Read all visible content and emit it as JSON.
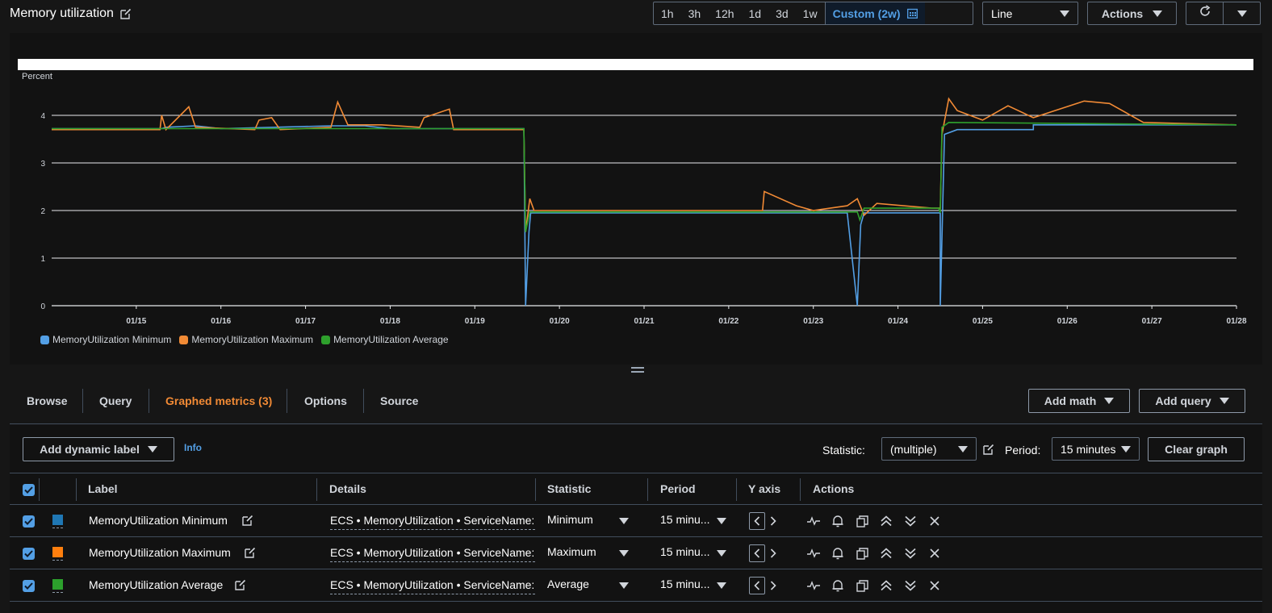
{
  "header": {
    "title": "Memory utilization",
    "time_ranges": [
      "1h",
      "3h",
      "12h",
      "1d",
      "3d",
      "1w"
    ],
    "custom_range": "Custom (2w)",
    "chart_type": "Line",
    "actions_label": "Actions"
  },
  "chart_data": {
    "type": "line",
    "ylabel": "Percent",
    "ylim": [
      0,
      4
    ],
    "yticks": [
      "0",
      "1",
      "2",
      "3",
      "4"
    ],
    "xticks": [
      "01/15",
      "01/16",
      "01/17",
      "01/18",
      "01/19",
      "01/20",
      "01/21",
      "01/22",
      "01/23",
      "01/24",
      "01/25",
      "01/26",
      "01/27",
      "01/28"
    ],
    "x_start": "01/14",
    "x_end": "01/28",
    "grid": "horizontal",
    "legend_position": "bottom-left",
    "series": [
      {
        "name": "MemoryUtilization Minimum",
        "color": "#539fe5",
        "points": [
          [
            "01/14",
            3.72
          ],
          [
            "01/15.3",
            3.72
          ],
          [
            "01/15.35",
            3.75
          ],
          [
            "01/15.7",
            3.78
          ],
          [
            "01/16",
            3.72
          ],
          [
            "01/17.3",
            3.78
          ],
          [
            "01/17.7",
            3.78
          ],
          [
            "01/18",
            3.72
          ],
          [
            "01/19.58",
            3.72
          ],
          [
            "01/19.6",
            0
          ],
          [
            "01/19.64",
            1.55
          ],
          [
            "01/19.66",
            1.95
          ],
          [
            "01/22",
            1.95
          ],
          [
            "01/22.5",
            1.95
          ],
          [
            "01/23.4",
            1.95
          ],
          [
            "01/23.52",
            0
          ],
          [
            "01/23.56",
            1.7
          ],
          [
            "01/23.6",
            1.95
          ],
          [
            "01/24.0",
            1.95
          ],
          [
            "01/24.5",
            1.95
          ],
          [
            "01/24.5",
            0
          ],
          [
            "01/24.55",
            3.6
          ],
          [
            "01/24.7",
            3.7
          ],
          [
            "01/25.6",
            3.7
          ],
          [
            "01/25.6",
            3.8
          ],
          [
            "01/28",
            3.8
          ]
        ]
      },
      {
        "name": "MemoryUtilization Maximum",
        "color": "#f18a35",
        "points": [
          [
            "01/14",
            3.7
          ],
          [
            "01/15.28",
            3.7
          ],
          [
            "01/15.3",
            4.0
          ],
          [
            "01/15.35",
            3.7
          ],
          [
            "01/15.62",
            4.18
          ],
          [
            "01/15.7",
            3.75
          ],
          [
            "01/16.4",
            3.7
          ],
          [
            "01/16.45",
            3.9
          ],
          [
            "01/16.6",
            3.95
          ],
          [
            "01/16.7",
            3.7
          ],
          [
            "01/17.3",
            3.75
          ],
          [
            "01/17.38",
            4.28
          ],
          [
            "01/17.5",
            3.8
          ],
          [
            "01/17.9",
            3.8
          ],
          [
            "01/18.35",
            3.75
          ],
          [
            "01/18.4",
            3.95
          ],
          [
            "01/18.7",
            4.13
          ],
          [
            "01/18.75",
            3.7
          ],
          [
            "01/19.58",
            3.7
          ],
          [
            "01/19.6",
            1.55
          ],
          [
            "01/19.65",
            2.25
          ],
          [
            "01/19.7",
            2.0
          ],
          [
            "01/22.4",
            2.0
          ],
          [
            "01/22.42",
            2.4
          ],
          [
            "01/22.8",
            2.1
          ],
          [
            "01/23.0",
            2.0
          ],
          [
            "01/23.4",
            2.1
          ],
          [
            "01/23.52",
            2.25
          ],
          [
            "01/23.6",
            1.9
          ],
          [
            "01/23.75",
            2.15
          ],
          [
            "01/24.4",
            2.05
          ],
          [
            "01/24.5",
            2.05
          ],
          [
            "01/24.52",
            3.6
          ],
          [
            "01/24.6",
            4.35
          ],
          [
            "01/24.7",
            4.1
          ],
          [
            "01/25",
            3.9
          ],
          [
            "01/25.3",
            4.2
          ],
          [
            "01/25.6",
            3.95
          ],
          [
            "01/26.2",
            4.3
          ],
          [
            "01/26.5",
            4.25
          ],
          [
            "01/26.9",
            3.85
          ],
          [
            "01/28",
            3.8
          ]
        ]
      },
      {
        "name": "MemoryUtilization Average",
        "color": "#2ea02c",
        "points": [
          [
            "01/14",
            3.72
          ],
          [
            "01/19.58",
            3.72
          ],
          [
            "01/19.6",
            1.55
          ],
          [
            "01/19.65",
            1.97
          ],
          [
            "01/23.52",
            1.97
          ],
          [
            "01/23.55",
            1.8
          ],
          [
            "01/23.6",
            2.05
          ],
          [
            "01/24.48",
            2.05
          ],
          [
            "01/24.5",
            1.95
          ],
          [
            "01/24.52",
            3.75
          ],
          [
            "01/24.6",
            3.85
          ],
          [
            "01/28",
            3.8
          ]
        ]
      }
    ]
  },
  "legend": [
    {
      "label": "MemoryUtilization Minimum",
      "color": "#539fe5"
    },
    {
      "label": "MemoryUtilization Maximum",
      "color": "#f18a35"
    },
    {
      "label": "MemoryUtilization Average",
      "color": "#2ea02c"
    }
  ],
  "tabs": {
    "browse": "Browse",
    "query": "Query",
    "graphed": "Graphed metrics (3)",
    "options": "Options",
    "source": "Source",
    "add_math": "Add math",
    "add_query": "Add query"
  },
  "toolbar": {
    "add_dynamic_label": "Add dynamic label",
    "info": "Info",
    "statistic_label": "Statistic:",
    "statistic_value": "(multiple)",
    "period_label": "Period:",
    "period_value": "15 minutes",
    "clear_graph": "Clear graph"
  },
  "table": {
    "headers": {
      "label": "Label",
      "details": "Details",
      "statistic": "Statistic",
      "period": "Period",
      "yaxis": "Y axis",
      "actions": "Actions"
    },
    "rows": [
      {
        "label": "MemoryUtilization Minimum",
        "color": "#1f77b4",
        "details": "ECS • MemoryUtilization • ServiceName:",
        "statistic": "Minimum",
        "period": "15 minu..."
      },
      {
        "label": "MemoryUtilization Maximum",
        "color": "#ff7f0e",
        "details": "ECS • MemoryUtilization • ServiceName:",
        "statistic": "Maximum",
        "period": "15 minu..."
      },
      {
        "label": "MemoryUtilization Average",
        "color": "#2ca02c",
        "details": "ECS • MemoryUtilization • ServiceName:",
        "statistic": "Average",
        "period": "15 minu..."
      }
    ]
  }
}
